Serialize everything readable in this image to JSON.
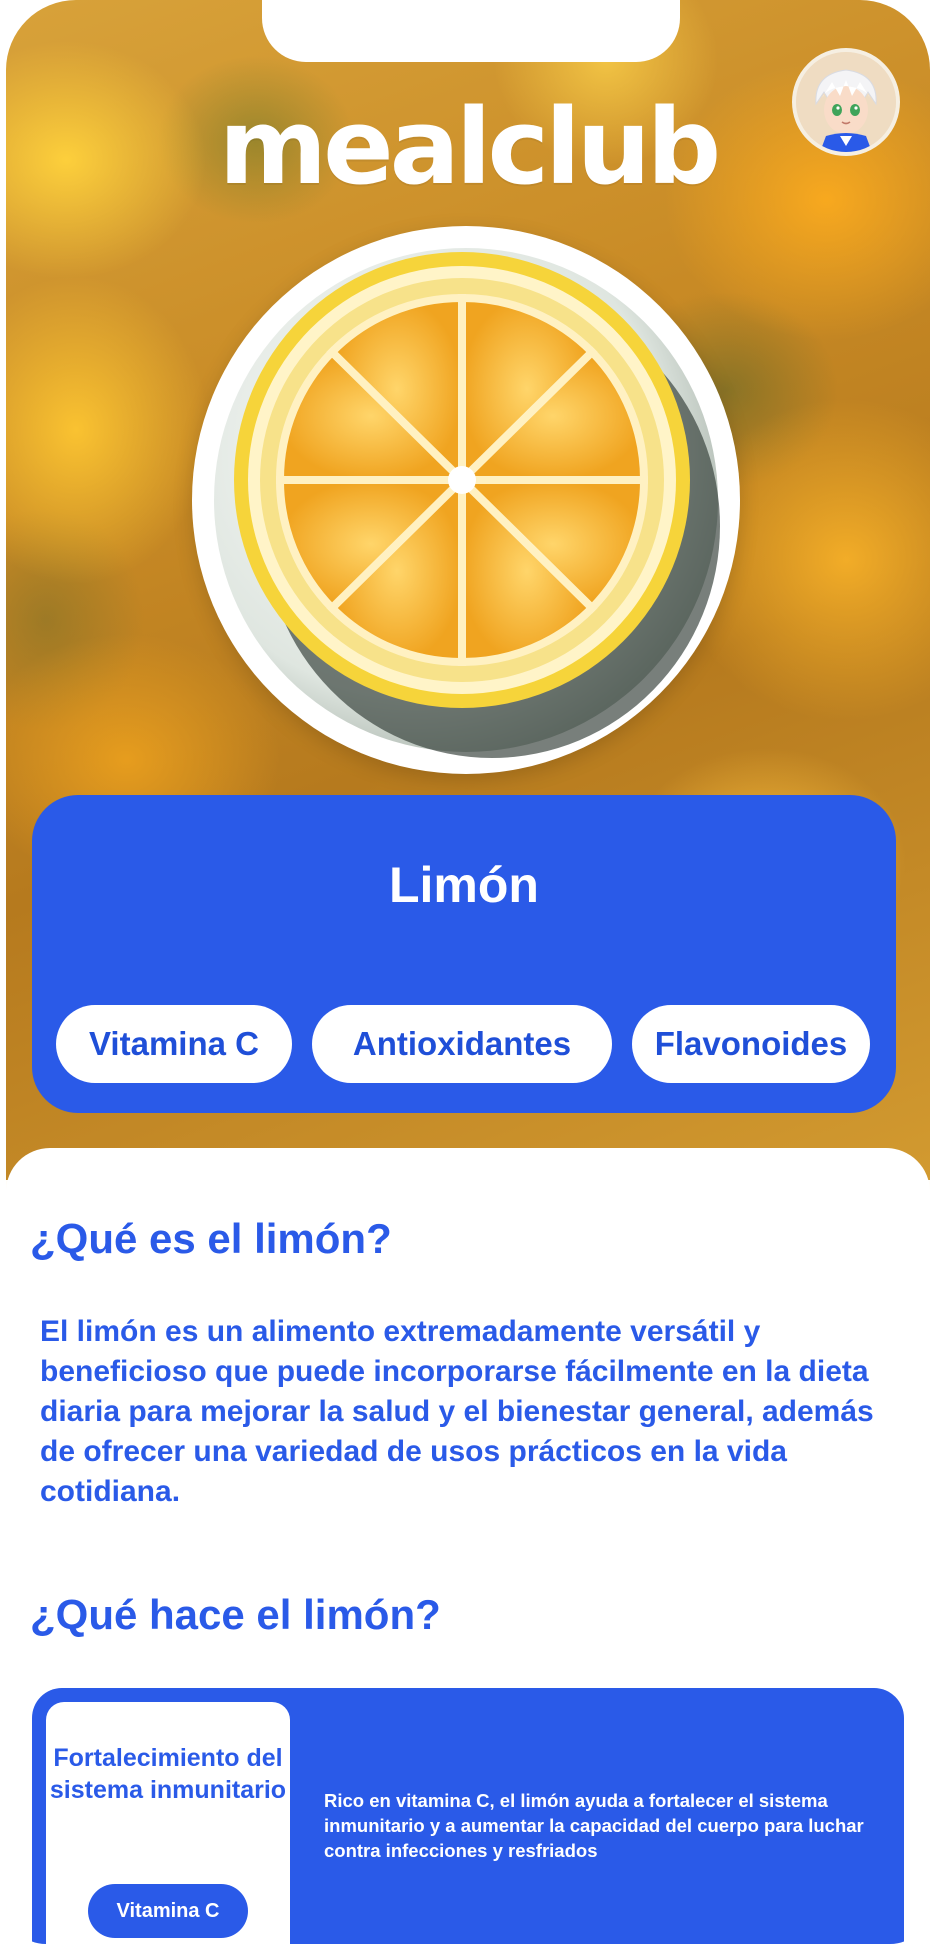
{
  "app": {
    "logo": "mealclub"
  },
  "user": {
    "avatar_icon": "anime-character-avatar"
  },
  "food": {
    "name": "Limón",
    "image_icon": "lemon-slice-plate",
    "tags": [
      "Vitamina C",
      "Antioxidantes",
      "Flavonoides"
    ]
  },
  "sections": {
    "what_is": {
      "heading": "¿Qué es el limón?",
      "text": "El limón es un alimento extremadamente versátil y beneficioso que puede incorporarse fácilmente en la dieta diaria para mejorar la salud y el bienestar general, además de ofrecer una variedad de usos prácticos en la vida cotidiana."
    },
    "what_does": {
      "heading": "¿Qué hace el limón?",
      "benefits": [
        {
          "title": "Fortalecimiento del sistema inmunitario",
          "tag": "Vitamina C",
          "description": "Rico en vitamina C, el limón ayuda a fortalecer el sistema inmunitario y a aumentar la capacidad del cuerpo para luchar contra infecciones y resfriados"
        }
      ]
    }
  },
  "colors": {
    "primary": "#2a5ae8",
    "white": "#ffffff",
    "lemon": "#f2b430"
  }
}
